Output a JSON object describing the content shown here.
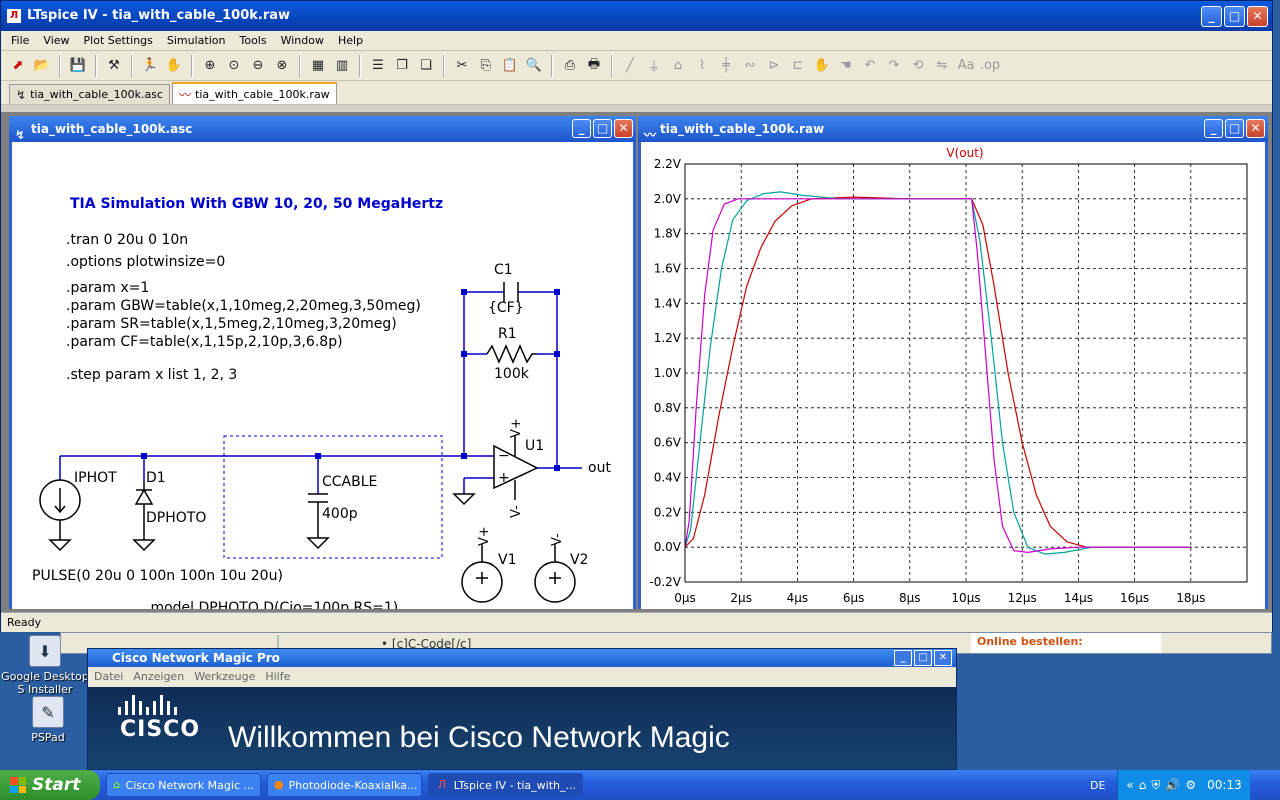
{
  "app": {
    "title": "LTspice IV - tia_with_cable_100k.raw",
    "menu": [
      "File",
      "View",
      "Plot Settings",
      "Simulation",
      "Tools",
      "Window",
      "Help"
    ],
    "tabs": [
      {
        "label": "tia_with_cable_100k.asc",
        "active": false
      },
      {
        "label": "tia_with_cable_100k.raw",
        "active": true
      }
    ],
    "status": "Ready"
  },
  "schematic": {
    "window_title": "tia_with_cable_100k.asc",
    "heading": "TIA Simulation With GBW 10, 20, 50 MegaHertz",
    "directives": [
      ".tran 0 20u 0 10n",
      ".options plotwinsize=0",
      ".param x=1",
      ".param GBW=table(x,1,10meg,2,20meg,3,50meg)",
      ".param SR=table(x,1,5meg,2,10meg,3,20meg)",
      ".param CF=table(x,1,15p,2,10p,3,6.8p)",
      ".step param x list 1, 2, 3"
    ],
    "labels": {
      "c1": "C1",
      "c1_value": "{CF}",
      "r1": "R1",
      "r1_value": "100k",
      "u1": "U1",
      "out": "out",
      "iphot": "IPHOT",
      "d1": "D1",
      "dphoto": "DPHOTO",
      "ccable": "CCABLE",
      "ccable_value": "400p",
      "v1": "V1",
      "v2": "V2",
      "vplus": "V+",
      "vminus": "V-",
      "pulse": "PULSE(0 20u 0 100n 100n 10u 20u)",
      "model": ".model DPHOTO D(Cjo=100p RS=1)"
    }
  },
  "plot": {
    "window_title": "tia_with_cable_100k.raw",
    "trace_title": "V(out)",
    "chart_data": {
      "type": "line",
      "title": "V(out)",
      "xlabel": "",
      "ylabel": "",
      "x_unit": "µs",
      "y_unit": "V",
      "xlim": [
        0,
        20
      ],
      "ylim": [
        -0.2,
        2.2
      ],
      "x_ticks": [
        "0µs",
        "2µs",
        "4µs",
        "6µs",
        "8µs",
        "10µs",
        "12µs",
        "14µs",
        "16µs",
        "18µs"
      ],
      "y_ticks": [
        "2.2V",
        "2.0V",
        "1.8V",
        "1.6V",
        "1.4V",
        "1.2V",
        "1.0V",
        "0.8V",
        "0.6V",
        "0.4V",
        "0.2V",
        "0.0V",
        "-0.2V"
      ],
      "grid": true,
      "series": [
        {
          "color": "#cc0000",
          "points": [
            [
              0,
              0
            ],
            [
              0.3,
              0.05
            ],
            [
              0.7,
              0.3
            ],
            [
              1.2,
              0.75
            ],
            [
              1.7,
              1.15
            ],
            [
              2.2,
              1.5
            ],
            [
              2.7,
              1.72
            ],
            [
              3.2,
              1.87
            ],
            [
              3.8,
              1.96
            ],
            [
              4.5,
              2.0
            ],
            [
              6,
              2.01
            ],
            [
              8,
              2.0
            ],
            [
              10.2,
              2.0
            ],
            [
              10.6,
              1.85
            ],
            [
              11.0,
              1.5
            ],
            [
              11.5,
              1.0
            ],
            [
              12.0,
              0.6
            ],
            [
              12.5,
              0.3
            ],
            [
              13.0,
              0.12
            ],
            [
              13.6,
              0.03
            ],
            [
              14.3,
              0.0
            ],
            [
              16,
              0.0
            ],
            [
              18,
              0.0
            ]
          ]
        },
        {
          "color": "#00a0a0",
          "points": [
            [
              0,
              0
            ],
            [
              0.2,
              0.1
            ],
            [
              0.5,
              0.55
            ],
            [
              0.9,
              1.15
            ],
            [
              1.3,
              1.6
            ],
            [
              1.7,
              1.88
            ],
            [
              2.2,
              1.99
            ],
            [
              2.8,
              2.03
            ],
            [
              3.4,
              2.04
            ],
            [
              4.2,
              2.02
            ],
            [
              5.5,
              2.0
            ],
            [
              8,
              2.0
            ],
            [
              10.2,
              2.0
            ],
            [
              10.5,
              1.75
            ],
            [
              10.9,
              1.2
            ],
            [
              11.3,
              0.6
            ],
            [
              11.7,
              0.2
            ],
            [
              12.2,
              0.0
            ],
            [
              12.8,
              -0.04
            ],
            [
              13.5,
              -0.03
            ],
            [
              14.5,
              0.0
            ],
            [
              16,
              0.0
            ],
            [
              18,
              0.0
            ]
          ]
        },
        {
          "color": "#cc00cc",
          "points": [
            [
              0,
              0
            ],
            [
              0.15,
              0.15
            ],
            [
              0.4,
              0.8
            ],
            [
              0.7,
              1.45
            ],
            [
              1.0,
              1.82
            ],
            [
              1.4,
              1.97
            ],
            [
              1.9,
              2.0
            ],
            [
              2.5,
              2.0
            ],
            [
              4,
              2.0
            ],
            [
              8,
              2.0
            ],
            [
              10.2,
              2.0
            ],
            [
              10.4,
              1.7
            ],
            [
              10.7,
              1.1
            ],
            [
              11.0,
              0.5
            ],
            [
              11.3,
              0.12
            ],
            [
              11.7,
              -0.02
            ],
            [
              12.2,
              -0.03
            ],
            [
              13,
              -0.01
            ],
            [
              14,
              0.0
            ],
            [
              16,
              0.0
            ],
            [
              18,
              0.0
            ]
          ]
        }
      ]
    }
  },
  "cisco": {
    "title": "Cisco Network Magic Pro",
    "menu": [
      "Datei",
      "Anzeigen",
      "Werkzeuge",
      "Hilfe"
    ],
    "logo": "CISCO",
    "welcome": "Willkommen bei Cisco Network Magic"
  },
  "background_window": {
    "bullet": "[c]C-Code[/c]",
    "ad": "Online bestellen:"
  },
  "desktop_icons": [
    {
      "label": "Google Desktop S Installer"
    },
    {
      "label": "PSPad"
    }
  ],
  "taskbar": {
    "start": "Start",
    "items": [
      {
        "label": "Cisco Network Magic ...",
        "active": false
      },
      {
        "label": "Photodiode-Koaxialka...",
        "active": false
      },
      {
        "label": "LTspice IV - tia_with_...",
        "active": true
      }
    ],
    "lang": "DE",
    "clock": "00:13"
  }
}
